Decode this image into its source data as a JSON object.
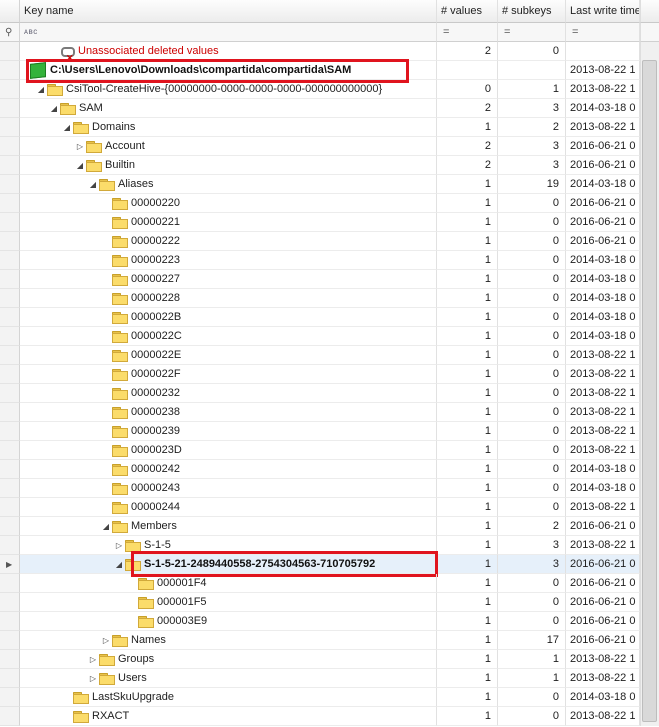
{
  "columns": {
    "key": "Key name",
    "values": "# values",
    "subkeys": "# subkeys",
    "time": "Last write timesta"
  },
  "filter": {
    "key_placeholder": "ᴀʙc",
    "values": "=",
    "subkeys": "=",
    "time": "="
  },
  "rows": [
    {
      "label": "Unassociated deleted values",
      "values": "2",
      "subkeys": "0",
      "time": "",
      "icon": "deleted-values-icon",
      "level": 2,
      "expander": "",
      "style": "red"
    },
    {
      "label": "C:\\Users\\Lenovo\\Downloads\\compartida\\compartida\\SAM",
      "values": "",
      "subkeys": "",
      "time": "2013-08-22 1",
      "icon": "hive-icon",
      "level": 0,
      "expander": "",
      "style": "bold",
      "boxed": true
    },
    {
      "label": "CsiTool-CreateHive-{00000000-0000-0000-0000-000000000000}",
      "values": "0",
      "subkeys": "1",
      "time": "2013-08-22 1",
      "icon": "folder-icon",
      "level": 1,
      "expander": "◢",
      "style": ""
    },
    {
      "label": "SAM",
      "values": "2",
      "subkeys": "3",
      "time": "2014-03-18 0",
      "icon": "folder-icon",
      "level": 2,
      "expander": "◢",
      "style": ""
    },
    {
      "label": "Domains",
      "values": "1",
      "subkeys": "2",
      "time": "2013-08-22 1",
      "icon": "folder-icon",
      "level": 3,
      "expander": "◢",
      "style": ""
    },
    {
      "label": "Account",
      "values": "2",
      "subkeys": "3",
      "time": "2016-06-21 0",
      "icon": "folder-icon",
      "level": 4,
      "expander": "▷",
      "style": ""
    },
    {
      "label": "Builtin",
      "values": "2",
      "subkeys": "3",
      "time": "2016-06-21 0",
      "icon": "folder-icon",
      "level": 4,
      "expander": "◢",
      "style": ""
    },
    {
      "label": "Aliases",
      "values": "1",
      "subkeys": "19",
      "time": "2014-03-18 0",
      "icon": "folder-icon",
      "level": 5,
      "expander": "◢",
      "style": ""
    },
    {
      "label": "00000220",
      "values": "1",
      "subkeys": "0",
      "time": "2016-06-21 0",
      "icon": "folder-icon",
      "level": 6,
      "expander": "",
      "style": ""
    },
    {
      "label": "00000221",
      "values": "1",
      "subkeys": "0",
      "time": "2016-06-21 0",
      "icon": "folder-icon",
      "level": 6,
      "expander": "",
      "style": ""
    },
    {
      "label": "00000222",
      "values": "1",
      "subkeys": "0",
      "time": "2016-06-21 0",
      "icon": "folder-icon",
      "level": 6,
      "expander": "",
      "style": ""
    },
    {
      "label": "00000223",
      "values": "1",
      "subkeys": "0",
      "time": "2014-03-18 0",
      "icon": "folder-icon",
      "level": 6,
      "expander": "",
      "style": ""
    },
    {
      "label": "00000227",
      "values": "1",
      "subkeys": "0",
      "time": "2014-03-18 0",
      "icon": "folder-icon",
      "level": 6,
      "expander": "",
      "style": ""
    },
    {
      "label": "00000228",
      "values": "1",
      "subkeys": "0",
      "time": "2014-03-18 0",
      "icon": "folder-icon",
      "level": 6,
      "expander": "",
      "style": ""
    },
    {
      "label": "0000022B",
      "values": "1",
      "subkeys": "0",
      "time": "2014-03-18 0",
      "icon": "folder-icon",
      "level": 6,
      "expander": "",
      "style": ""
    },
    {
      "label": "0000022C",
      "values": "1",
      "subkeys": "0",
      "time": "2014-03-18 0",
      "icon": "folder-icon",
      "level": 6,
      "expander": "",
      "style": ""
    },
    {
      "label": "0000022E",
      "values": "1",
      "subkeys": "0",
      "time": "2013-08-22 1",
      "icon": "folder-icon",
      "level": 6,
      "expander": "",
      "style": ""
    },
    {
      "label": "0000022F",
      "values": "1",
      "subkeys": "0",
      "time": "2013-08-22 1",
      "icon": "folder-icon",
      "level": 6,
      "expander": "",
      "style": ""
    },
    {
      "label": "00000232",
      "values": "1",
      "subkeys": "0",
      "time": "2013-08-22 1",
      "icon": "folder-icon",
      "level": 6,
      "expander": "",
      "style": ""
    },
    {
      "label": "00000238",
      "values": "1",
      "subkeys": "0",
      "time": "2013-08-22 1",
      "icon": "folder-icon",
      "level": 6,
      "expander": "",
      "style": ""
    },
    {
      "label": "00000239",
      "values": "1",
      "subkeys": "0",
      "time": "2013-08-22 1",
      "icon": "folder-icon",
      "level": 6,
      "expander": "",
      "style": ""
    },
    {
      "label": "0000023D",
      "values": "1",
      "subkeys": "0",
      "time": "2013-08-22 1",
      "icon": "folder-icon",
      "level": 6,
      "expander": "",
      "style": ""
    },
    {
      "label": "00000242",
      "values": "1",
      "subkeys": "0",
      "time": "2014-03-18 0",
      "icon": "folder-icon",
      "level": 6,
      "expander": "",
      "style": ""
    },
    {
      "label": "00000243",
      "values": "1",
      "subkeys": "0",
      "time": "2014-03-18 0",
      "icon": "folder-icon",
      "level": 6,
      "expander": "",
      "style": ""
    },
    {
      "label": "00000244",
      "values": "1",
      "subkeys": "0",
      "time": "2013-08-22 1",
      "icon": "folder-icon",
      "level": 6,
      "expander": "",
      "style": ""
    },
    {
      "label": "Members",
      "values": "1",
      "subkeys": "2",
      "time": "2016-06-21 0",
      "icon": "folder-icon",
      "level": 6,
      "expander": "◢",
      "style": ""
    },
    {
      "label": "S-1-5",
      "values": "1",
      "subkeys": "3",
      "time": "2013-08-22 1",
      "icon": "folder-icon",
      "level": 7,
      "expander": "▷",
      "style": ""
    },
    {
      "label": "S-1-5-21-2489440558-2754304563-710705792",
      "values": "1",
      "subkeys": "3",
      "time": "2016-06-21 0",
      "icon": "folder-icon",
      "level": 7,
      "expander": "◢",
      "style": "bold",
      "boxed": true,
      "selected": true
    },
    {
      "label": "000001F4",
      "values": "1",
      "subkeys": "0",
      "time": "2016-06-21 0",
      "icon": "folder-icon",
      "level": 8,
      "expander": "",
      "style": ""
    },
    {
      "label": "000001F5",
      "values": "1",
      "subkeys": "0",
      "time": "2016-06-21 0",
      "icon": "folder-icon",
      "level": 8,
      "expander": "",
      "style": ""
    },
    {
      "label": "000003E9",
      "values": "1",
      "subkeys": "0",
      "time": "2016-06-21 0",
      "icon": "folder-icon",
      "level": 8,
      "expander": "",
      "style": ""
    },
    {
      "label": "Names",
      "values": "1",
      "subkeys": "17",
      "time": "2016-06-21 0",
      "icon": "folder-icon",
      "level": 6,
      "expander": "▷",
      "style": ""
    },
    {
      "label": "Groups",
      "values": "1",
      "subkeys": "1",
      "time": "2013-08-22 1",
      "icon": "folder-icon",
      "level": 5,
      "expander": "▷",
      "style": ""
    },
    {
      "label": "Users",
      "values": "1",
      "subkeys": "1",
      "time": "2013-08-22 1",
      "icon": "folder-icon",
      "level": 5,
      "expander": "▷",
      "style": ""
    },
    {
      "label": "LastSkuUpgrade",
      "values": "1",
      "subkeys": "0",
      "time": "2014-03-18 0",
      "icon": "folder-icon",
      "level": 3,
      "expander": "",
      "style": ""
    },
    {
      "label": "RXACT",
      "values": "1",
      "subkeys": "0",
      "time": "2013-08-22 1",
      "icon": "folder-icon",
      "level": 3,
      "expander": "",
      "style": ""
    }
  ],
  "colors": {
    "highlight_box": "#e0141e",
    "deleted_text": "#cc0000",
    "selected_row": "#e6f0fa"
  }
}
